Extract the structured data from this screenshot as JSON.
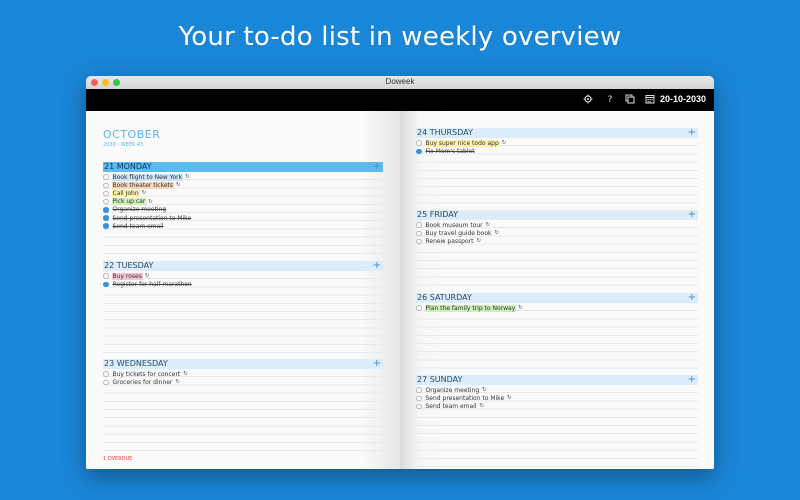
{
  "headline": "Your to-do list in weekly overview",
  "window": {
    "title": "Doweek",
    "toolbar": {
      "icons": [
        "settings-icon",
        "help-icon",
        "copy-icon",
        "calendar-icon"
      ],
      "date": "20-10-2030"
    }
  },
  "left_page": {
    "month": "OCTOBER",
    "week_info": "2030 - WEEK 43",
    "overdue": "1 OVERDUE"
  },
  "days": [
    {
      "label": "21 MONDAY",
      "today": true,
      "tasks": [
        {
          "text": "Book flight to New York",
          "done": false,
          "highlight": "#cde4fb",
          "repeat": true
        },
        {
          "text": "Book theater tickets",
          "done": false,
          "highlight": "#f8d7b8",
          "repeat": true
        },
        {
          "text": "Call John",
          "done": false,
          "highlight": "#fbf3a8",
          "repeat": true
        },
        {
          "text": "Pick up car",
          "done": false,
          "highlight": "#cdefb8",
          "repeat": true
        },
        {
          "text": "Organize meeting",
          "done": true,
          "highlight": "",
          "repeat": false
        },
        {
          "text": "Send presentation to Mike",
          "done": true,
          "highlight": "",
          "repeat": false
        },
        {
          "text": "Send team email",
          "done": true,
          "highlight": "",
          "repeat": false
        }
      ]
    },
    {
      "label": "22 TUESDAY",
      "today": false,
      "tasks": [
        {
          "text": "Buy roses",
          "done": false,
          "highlight": "#f6c6d4",
          "repeat": true
        },
        {
          "text": "Register for half marathon",
          "done": true,
          "highlight": "",
          "repeat": false
        }
      ]
    },
    {
      "label": "23 WEDNESDAY",
      "today": false,
      "tasks": [
        {
          "text": "Buy tickets for concert",
          "done": false,
          "highlight": "",
          "repeat": true
        },
        {
          "text": "Groceries for dinner",
          "done": false,
          "highlight": "",
          "repeat": true
        }
      ]
    },
    {
      "label": "24 THURSDAY",
      "today": false,
      "tasks": [
        {
          "text": "Buy super nice todo app",
          "done": false,
          "highlight": "#fbf3a8",
          "repeat": true
        },
        {
          "text": "Fix Mom's tablet",
          "done": true,
          "highlight": "",
          "repeat": false
        }
      ]
    },
    {
      "label": "25 FRIDAY",
      "today": false,
      "tasks": [
        {
          "text": "Book museum tour",
          "done": false,
          "highlight": "",
          "repeat": true
        },
        {
          "text": "Buy travel guide book",
          "done": false,
          "highlight": "",
          "repeat": true
        },
        {
          "text": "Renew passport",
          "done": false,
          "highlight": "",
          "repeat": true
        }
      ]
    },
    {
      "label": "26 SATURDAY",
      "today": false,
      "tasks": [
        {
          "text": "Plan the family trip to Norway",
          "done": false,
          "highlight": "#cdefb8",
          "repeat": true
        }
      ]
    },
    {
      "label": "27 SUNDAY",
      "today": false,
      "tasks": [
        {
          "text": "Organize meeting",
          "done": false,
          "highlight": "",
          "repeat": true
        },
        {
          "text": "Send presentation to Mike",
          "done": false,
          "highlight": "",
          "repeat": true
        },
        {
          "text": "Send team email",
          "done": false,
          "highlight": "",
          "repeat": true
        }
      ]
    }
  ],
  "add_button_label": "+",
  "repeat_glyph": "↻"
}
